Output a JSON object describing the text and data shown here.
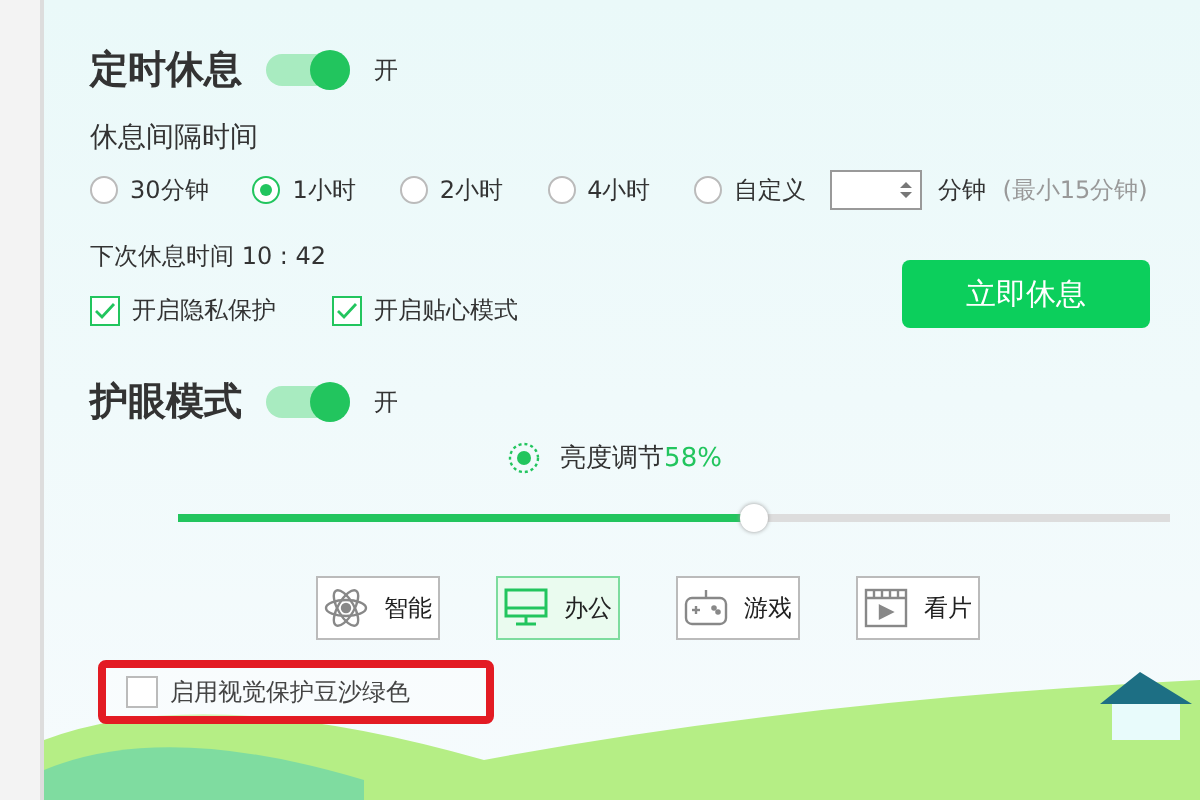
{
  "rest": {
    "title": "定时休息",
    "on": true,
    "toggle_label": "开",
    "interval_label": "休息间隔时间",
    "options": [
      {
        "label": "30分钟",
        "selected": false
      },
      {
        "label": "1小时",
        "selected": true
      },
      {
        "label": "2小时",
        "selected": false
      },
      {
        "label": "4小时",
        "selected": false
      },
      {
        "label": "自定义",
        "selected": false
      }
    ],
    "unit": "分钟",
    "hint": "(最小15分钟)",
    "next_time": "下次休息时间 10 : 42",
    "checkboxes": [
      {
        "label": "开启隐私保护",
        "checked": true
      },
      {
        "label": "开启贴心模式",
        "checked": true
      }
    ],
    "button": "立即休息"
  },
  "eye": {
    "title": "护眼模式",
    "on": true,
    "toggle_label": "开",
    "brightness_label": "亮度调节",
    "brightness_value": "58%",
    "level": 0.58,
    "modes": [
      {
        "kind": "smart",
        "label": "智能",
        "selected": false
      },
      {
        "kind": "office",
        "label": "办公",
        "selected": true
      },
      {
        "kind": "game",
        "label": "游戏",
        "selected": false
      },
      {
        "kind": "movie",
        "label": "看片",
        "selected": false
      }
    ],
    "green_option": {
      "label": "启用视觉保护豆沙绿色",
      "checked": false
    }
  }
}
